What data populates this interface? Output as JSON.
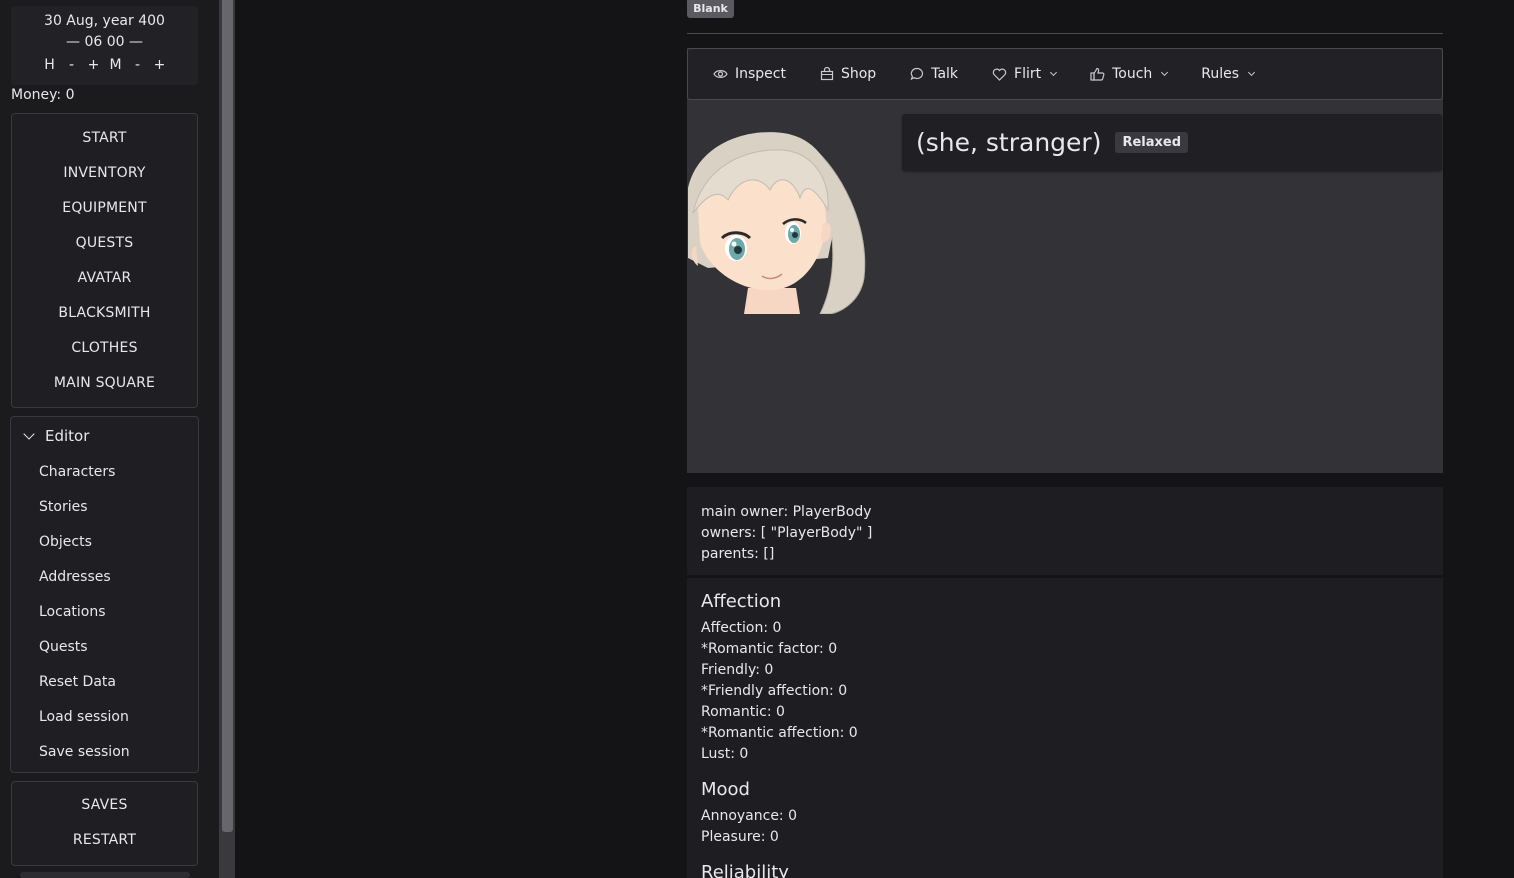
{
  "clock": {
    "date": "30 Aug, year 400",
    "time": "— 06 00 —",
    "controls": [
      "H",
      "-",
      "+",
      "M",
      "-",
      "+"
    ]
  },
  "money": "Money: 0",
  "main_nav": [
    "START",
    "INVENTORY",
    "EQUIPMENT",
    "QUESTS",
    "AVATAR",
    "BLACKSMITH",
    "CLOTHES",
    "MAIN SQUARE"
  ],
  "editor": {
    "title": "Editor",
    "items": [
      "Characters",
      "Stories",
      "Objects",
      "Addresses",
      "Locations",
      "Quests",
      "Reset Data",
      "Load session",
      "Save session"
    ]
  },
  "bottom_nav": [
    "SAVES",
    "RESTART"
  ],
  "badge": "Blank",
  "toolbar": [
    {
      "label": "Inspect",
      "icon": "eye-icon",
      "dropdown": false
    },
    {
      "label": "Shop",
      "icon": "shopping-bag-icon",
      "dropdown": false
    },
    {
      "label": "Talk",
      "icon": "speech-bubble-icon",
      "dropdown": false
    },
    {
      "label": "Flirt",
      "icon": "heart-icon",
      "dropdown": true
    },
    {
      "label": "Touch",
      "icon": "thumbs-up-icon",
      "dropdown": true
    },
    {
      "label": "Rules",
      "icon": "",
      "dropdown": true
    }
  ],
  "character": {
    "name": "(she, stranger)",
    "mood": "Relaxed"
  },
  "ownership": {
    "main_owner": "main owner: PlayerBody",
    "owners": "owners: [ \"PlayerBody\" ]",
    "parents": "parents: []"
  },
  "affection": {
    "title": "Affection",
    "lines": [
      "Affection: 0",
      "*Romantic factor: 0",
      "Friendly: 0",
      "*Friendly affection: 0",
      "Romantic: 0",
      "*Romantic affection: 0",
      "Lust: 0"
    ]
  },
  "mood": {
    "title": "Mood",
    "lines": [
      "Annoyance: 0",
      "Pleasure: 0"
    ]
  },
  "next_section_title": "Reliability",
  "colors": {
    "background": "#141316",
    "sidebar": "#1b1a1d",
    "card": "#333237",
    "text": "#e8e8ec"
  }
}
